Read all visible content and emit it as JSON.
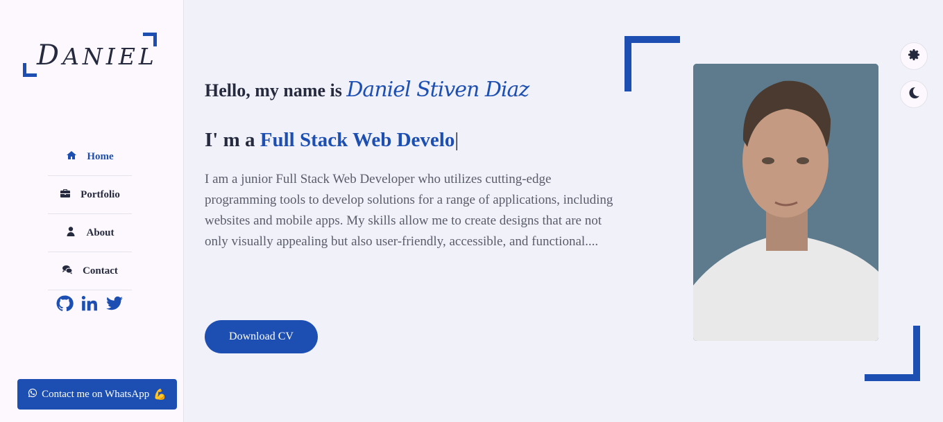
{
  "logo": {
    "first": "D",
    "rest": "ANIEL"
  },
  "nav": [
    {
      "label": "Home",
      "icon": "home-icon",
      "active": true
    },
    {
      "label": "Portfolio",
      "icon": "briefcase-icon",
      "active": false
    },
    {
      "label": "About",
      "icon": "user-icon",
      "active": false
    },
    {
      "label": "Contact",
      "icon": "comments-icon",
      "active": false
    }
  ],
  "socials": [
    "github-icon",
    "linkedin-icon",
    "twitter-icon"
  ],
  "whatsapp": {
    "label": "Contact me on WhatsApp",
    "emoji": "💪",
    "icon": "whatsapp-icon"
  },
  "hero": {
    "greeting": "Hello, my name is",
    "name": "Daniel Stiven Diaz",
    "role_prefix": "I' m a",
    "role_typed": "Full Stack Web Develo",
    "cursor": "|",
    "description": "I am a junior Full Stack Web Developer who utilizes cutting-edge programming tools to develop solutions for a range of applications, including websites and mobile apps. My skills allow me to create designs that are not only visually appealing but also user-friendly, accessible, and functional....",
    "cv_button": "Download CV"
  },
  "controls": {
    "settings_icon": "gear-icon",
    "theme_icon": "moon-icon"
  },
  "colors": {
    "accent": "#1d4fb2",
    "text": "#262a3e",
    "background": "#f1f1f9",
    "sidebar": "#fcf8fd"
  }
}
